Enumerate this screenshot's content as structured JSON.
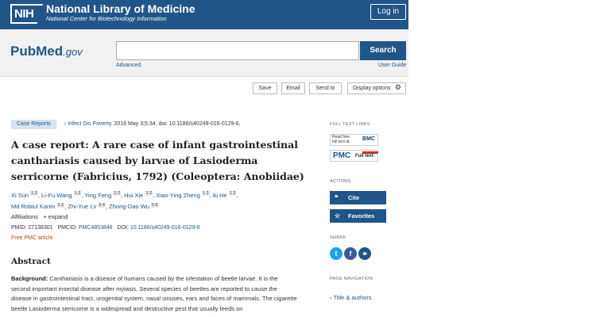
{
  "header": {
    "nih_logo": "NIH",
    "nlm_title": "National Library of Medicine",
    "nlm_subtitle": "National Center for Biotechnology Information",
    "login_label": "Log in"
  },
  "search": {
    "logo_pub": "Pub",
    "logo_med": "Med",
    "logo_gov": ".gov",
    "input_value": "",
    "button_label": "Search",
    "advanced_label": "Advanced",
    "user_guide_label": "User Guide"
  },
  "toolbar": {
    "save_label": "Save",
    "email_label": "Email",
    "send_to_label": "Send to",
    "display_options_label": "Display options"
  },
  "article": {
    "type_badge": "Case Reports",
    "journal": "Infect Dis Poverty",
    "citation": ". 2016 May 3;5:34. doi: 10.1186/s40249-016-0129-6.",
    "title": "A case report: A rare case of infant gastrointestinal canthariasis caused by larvae of Lasioderma serricorne (Fabricius, 1792) (Coleoptera: Anobiidae)",
    "authors": [
      {
        "name": "Xi Sun",
        "aff": "1 2"
      },
      {
        "name": "Li-Fu Wang",
        "aff": "1 2"
      },
      {
        "name": "Ying Feng",
        "aff": "1 2"
      },
      {
        "name": "Hui Xie",
        "aff": "1 2"
      },
      {
        "name": "Xiao-Ying Zheng",
        "aff": "1 2"
      },
      {
        "name": "Ai He",
        "aff": "1 2"
      },
      {
        "name": "Md Robiul Karim",
        "aff": "1 2"
      },
      {
        "name": "Zhi-Yue Lv",
        "aff": "3 4"
      },
      {
        "name": "Zhong-Dao Wu",
        "aff": "5 6"
      }
    ],
    "affiliations_label": "Affiliations",
    "expand_label": "expand",
    "pmid_label": "PMID:",
    "pmid": "27138301",
    "pmcid_label": "PMCID:",
    "pmcid": "PMC4853848",
    "doi_label": "DOI:",
    "doi": "10.1186/s40249-016-0129-6",
    "free_label": "Free PMC article",
    "abstract_heading": "Abstract",
    "abstract_bg_label": "Background:",
    "abstract_text": "Canthariasis is a disease of humans caused by the infestation of beetle larvae. It is the second important insectal disease after myiasis. Several species of beetles are reported to cause the disease in gastrointestinal tract, urogenital system, nasal sinuses, ears and faces of mammals. The cigarette beetle Lasioderma serricorne is a widespread and destructive pest that usually feeds on"
  },
  "sidebar": {
    "full_text_heading": "FULL TEXT LINKS",
    "bmc_text": "Read free full text at",
    "bmc_logo": "BMC",
    "pmc_logo": "PMC",
    "pmc_full_text": "Full text",
    "actions_heading": "ACTIONS",
    "cite_label": "Cite",
    "favorites_label": "Favorites",
    "share_heading": "SHARE",
    "page_nav_heading": "PAGE NAVIGATION",
    "title_authors_label": "Title & authors"
  },
  "colors": {
    "nih_blue": "#20558a",
    "free_text_orange": "#b5451b"
  }
}
